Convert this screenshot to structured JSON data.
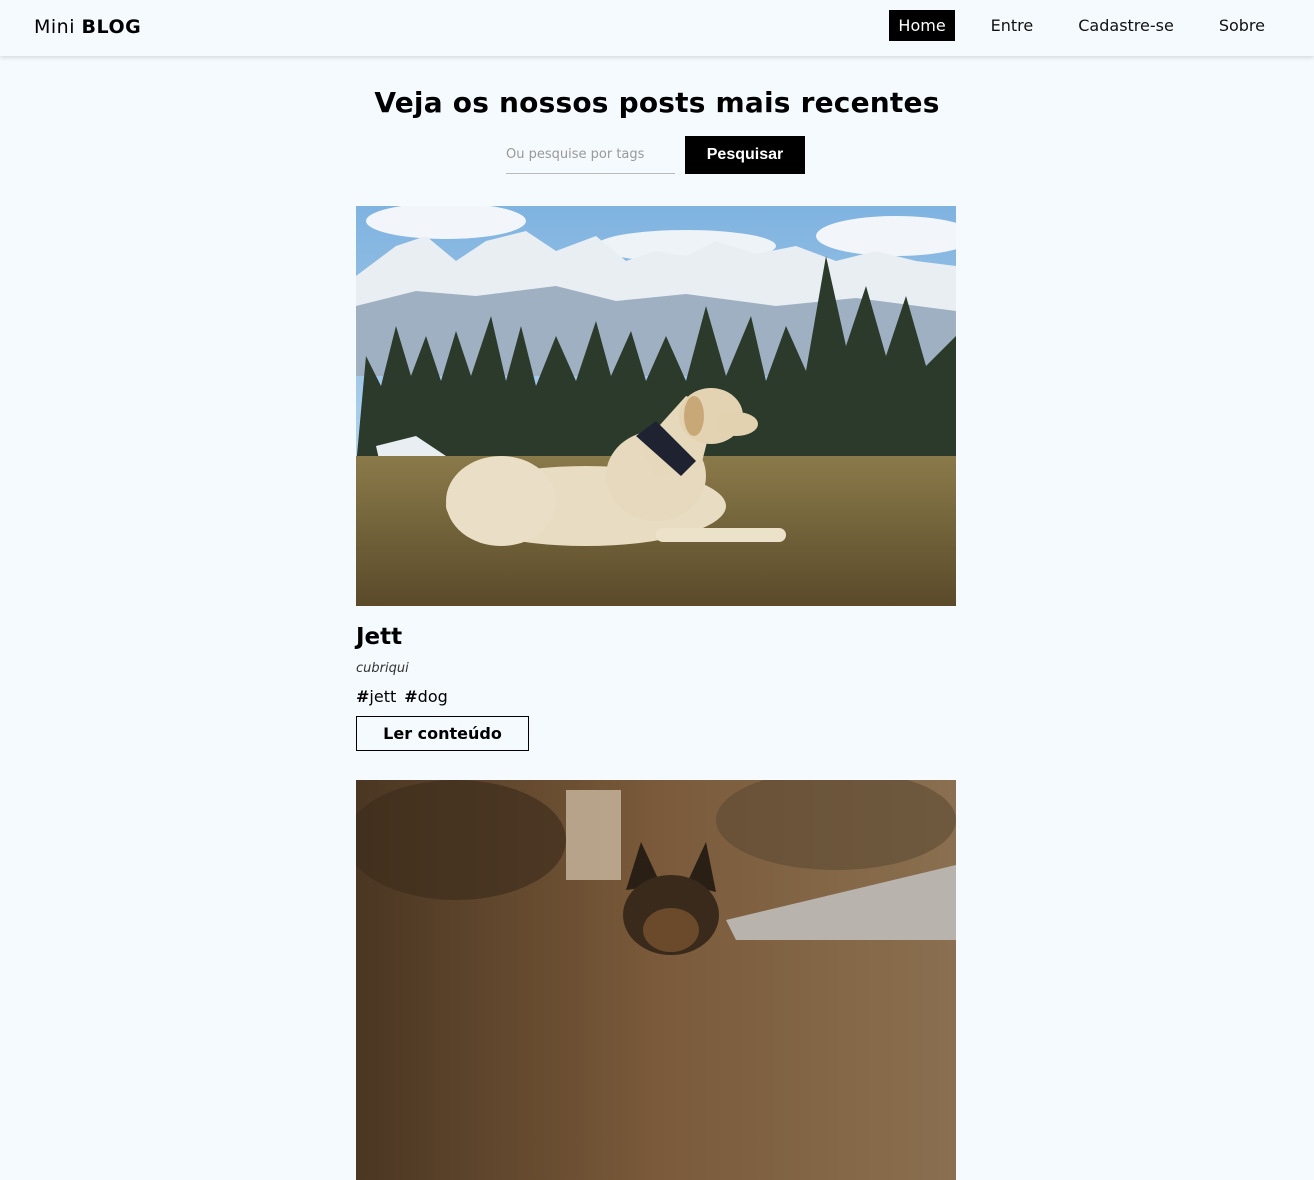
{
  "navbar": {
    "brand_light": "Mini",
    "brand_bold": "BLOG",
    "links": [
      {
        "label": "Home",
        "active": true
      },
      {
        "label": "Entre",
        "active": false
      },
      {
        "label": "Cadastre-se",
        "active": false
      },
      {
        "label": "Sobre",
        "active": false
      }
    ]
  },
  "main": {
    "title": "Veja os nossos posts mais recentes",
    "search": {
      "placeholder": "Ou pesquise por tags",
      "value": "",
      "button_label": "Pesquisar"
    }
  },
  "posts": [
    {
      "title": "Jett",
      "author": "cubriqui",
      "tags": [
        "jett",
        "dog"
      ],
      "read_label": "Ler conteúdo",
      "image": "labrador-mountain-photo"
    },
    {
      "image": "german-shepherd-photo"
    }
  ],
  "colors": {
    "background": "#f4fafe",
    "accent": "#000000"
  }
}
